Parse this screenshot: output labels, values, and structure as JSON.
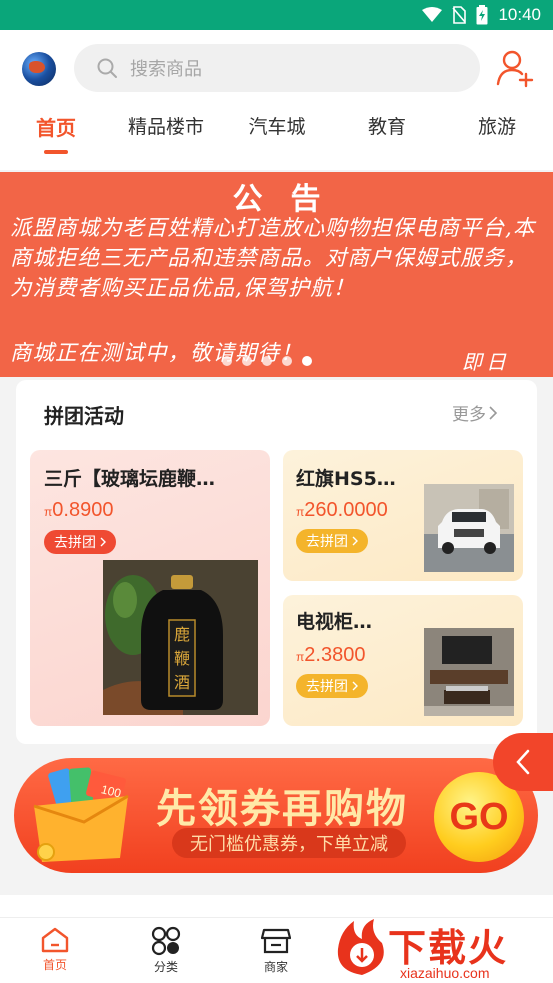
{
  "status_bar": {
    "time": "10:40"
  },
  "search": {
    "placeholder": "搜索商品"
  },
  "tabs": [
    {
      "label": "首页",
      "active": true
    },
    {
      "label": "精品楼市",
      "active": false
    },
    {
      "label": "汽车城",
      "active": false
    },
    {
      "label": "教育",
      "active": false
    },
    {
      "label": "旅游",
      "active": false
    }
  ],
  "notice": {
    "title": "公告",
    "body": "派盟商城为老百姓精心打造放心购物担保电商平台,本商城拒绝三无产品和违禁商品。对商户保姆式服务，为消费者购买正品优品,保驾护航！",
    "body2": "商城正在测试中，敬请期待！",
    "sign": "即日",
    "slide_count": 5,
    "active_slide": 5
  },
  "group_buy": {
    "title": "拼团活动",
    "more_label": "更多",
    "products": [
      {
        "name": "三斤【玻璃坛鹿鞭…",
        "currency": "π",
        "price": "0.8900",
        "button": "去拼团",
        "button_color": "#ef4a33",
        "image_text": "鹿鞭酒"
      },
      {
        "name": "红旗HS5…",
        "currency": "π",
        "price": "260.0000",
        "button": "去拼团",
        "button_color": "#f4b42b"
      },
      {
        "name": "电视柜…",
        "currency": "π",
        "price": "2.3800",
        "button": "去拼团",
        "button_color": "#f4b42b"
      }
    ]
  },
  "coupon_banner": {
    "main": "先领券再购物",
    "sub": "无门槛优惠券，下单立减",
    "go": "GO",
    "coupon_value": "100"
  },
  "bottom_nav": [
    {
      "label": "首页",
      "icon": "home-icon",
      "active": true
    },
    {
      "label": "分类",
      "icon": "category-icon",
      "active": false
    },
    {
      "label": "商家",
      "icon": "store-icon",
      "active": false
    }
  ],
  "watermark": {
    "text": "下载火",
    "url": "xiazaihuo.com"
  },
  "colors": {
    "accent": "#f2552c",
    "status_bar": "#0aa67a",
    "notice_bg": "#f26547"
  }
}
